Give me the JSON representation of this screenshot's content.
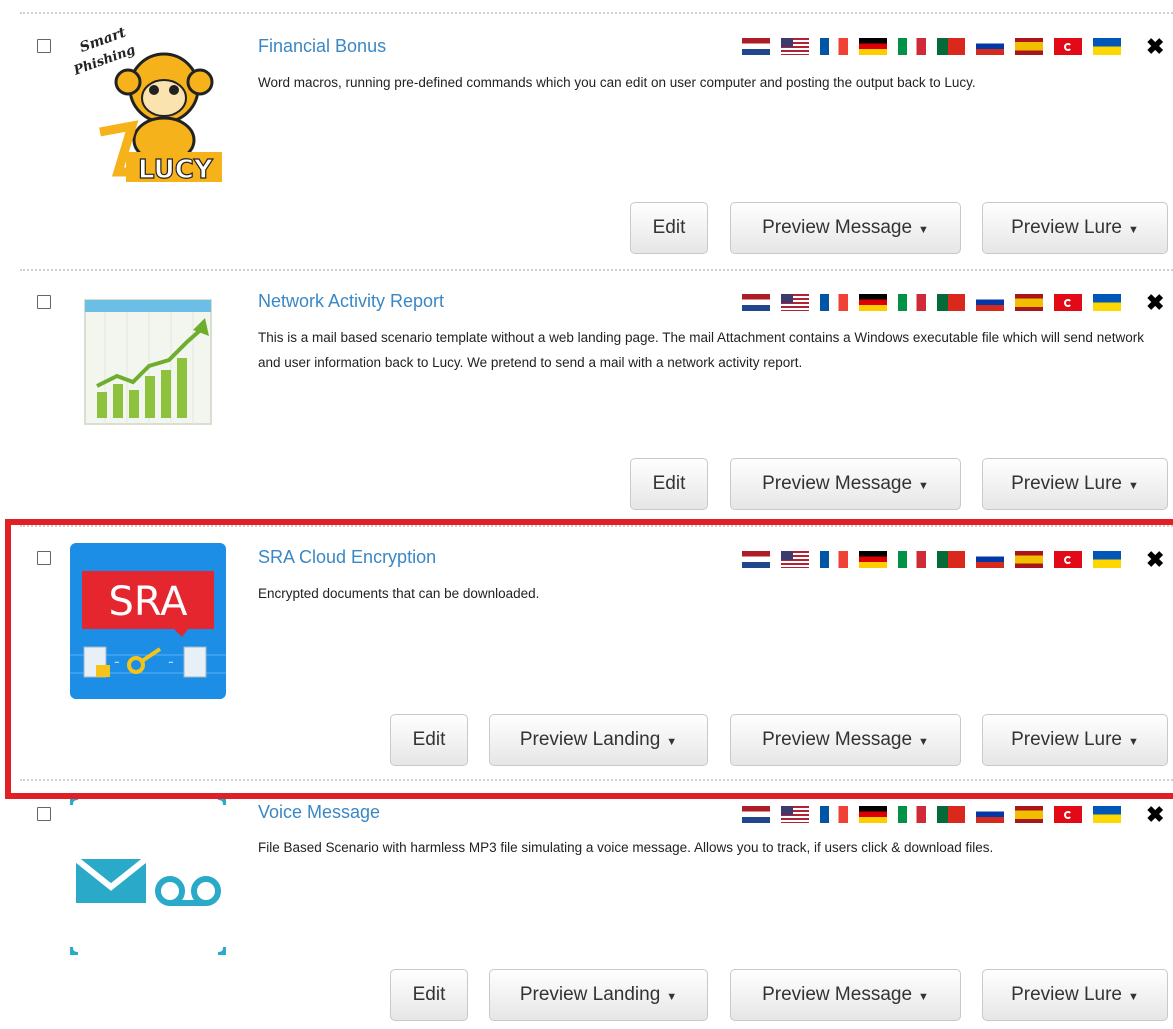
{
  "flag_names": [
    "nl-flag-icon",
    "us-flag-icon",
    "fr-flag-icon",
    "de-flag-icon",
    "it-flag-icon",
    "pt-flag-icon",
    "ru-flag-icon",
    "es-flag-icon",
    "tr-flag-icon",
    "ua-flag-icon"
  ],
  "buttons": {
    "edit": "Edit",
    "preview_landing": "Preview Landing",
    "preview_message": "Preview Message",
    "preview_lure": "Preview Lure"
  },
  "items": [
    {
      "title": "Financial Bonus",
      "description": "Word macros, running pre-defined commands which you can edit on user computer and posting the output back to Lucy.",
      "logo_text_top": "Smart Phishing",
      "logo_text_bottom": "Lucy",
      "has_landing": false
    },
    {
      "title": "Network Activity Report",
      "description": "This is a mail based scenario template without a web landing page. The mail Attachment contains a Windows executable file which will send network and user information back to Lucy. We pretend to send a mail with a network activity report.",
      "has_landing": false
    },
    {
      "title": "SRA Cloud Encryption",
      "description": "Encrypted documents that can be downloaded.",
      "logo_text": "SRA",
      "has_landing": true,
      "highlighted": true
    },
    {
      "title": "Voice Message",
      "description": "File Based Scenario with harmless MP3 file simulating a voice message. Allows you to track, if users click & download files.",
      "has_landing": true
    }
  ],
  "colors": {
    "title": "#3a87c5",
    "highlight_border": "#e02027"
  }
}
